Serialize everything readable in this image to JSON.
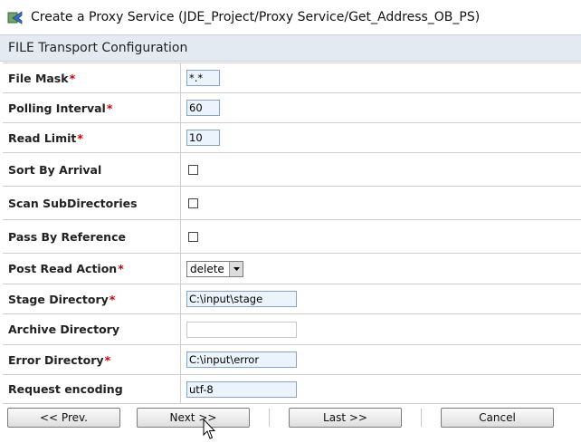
{
  "title": "Create a Proxy Service (JDE_Project/Proxy Service/Get_Address_OB_PS)",
  "section_header": "FILE Transport Configuration",
  "required_marker": "*",
  "fields": {
    "file_mask": {
      "label": "File Mask",
      "value": "*.*"
    },
    "polling_interval": {
      "label": "Polling Interval",
      "value": "60"
    },
    "read_limit": {
      "label": "Read Limit",
      "value": "10"
    },
    "sort_by_arrival": {
      "label": "Sort By Arrival",
      "checked": false
    },
    "scan_subdirectories": {
      "label": "Scan SubDirectories",
      "checked": false
    },
    "pass_by_reference": {
      "label": "Pass By Reference",
      "checked": false
    },
    "post_read_action": {
      "label": "Post Read Action",
      "value": "delete"
    },
    "stage_directory": {
      "label": "Stage Directory",
      "value": "C:\\input\\stage"
    },
    "archive_directory": {
      "label": "Archive Directory",
      "value": ""
    },
    "error_directory": {
      "label": "Error Directory",
      "value": "C:\\input\\error"
    },
    "request_encoding": {
      "label": "Request encoding",
      "value": "utf-8"
    }
  },
  "buttons": {
    "prev": "<< Prev.",
    "next": "Next >>",
    "last": "Last >>",
    "cancel": "Cancel"
  },
  "colors": {
    "required": "#d00000",
    "section_bg": "#e4eaf2",
    "input_bg": "#ebf4fc"
  },
  "icons": {
    "title": "proxy-service-icon",
    "cursor": "mouse-pointer-icon"
  }
}
